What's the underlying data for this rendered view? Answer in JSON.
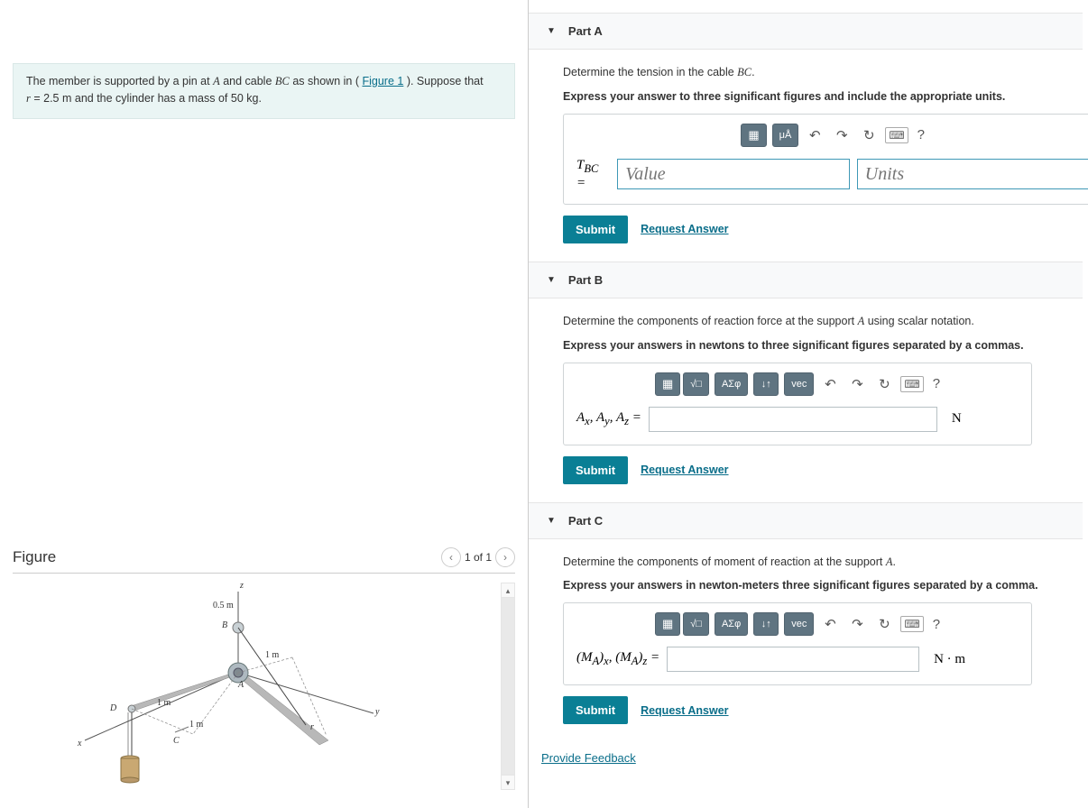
{
  "problem": {
    "text_before": "The member is supported by a pin at ",
    "varA": "A",
    "text_mid1": " and cable ",
    "varBC": "BC",
    "text_mid2": " as shown in (",
    "figure_link": "Figure 1",
    "text_mid3": "). Suppose that ",
    "varR": "r",
    "text_mid4": " = 2.5 m and the cylinder has a mass of 50 kg."
  },
  "figure": {
    "label": "Figure",
    "nav_text": "1 of 1",
    "labels": {
      "z": "z",
      "half_m": "0.5 m",
      "B": "B",
      "one_m_a": "1 m",
      "D": "D",
      "one_m_b": "1 m",
      "A": "A",
      "one_m_c": "1 m",
      "y": "y",
      "x": "x",
      "C": "C",
      "r": "r"
    }
  },
  "parts": {
    "a": {
      "title": "Part A",
      "prompt_before": "Determine the tension in the cable ",
      "prompt_var": "BC",
      "prompt_after": ".",
      "instruct": "Express your answer to three significant figures and include the appropriate units.",
      "toolbar": {
        "ua": "μÅ"
      },
      "label_html": "T<sub>BC</sub> =",
      "value_ph": "Value",
      "units_ph": "Units",
      "submit": "Submit",
      "request": "Request Answer"
    },
    "b": {
      "title": "Part B",
      "prompt_before": "Determine the components of reaction force at the support ",
      "prompt_var": "A",
      "prompt_after": " using scalar notation.",
      "instruct": "Express your answers in newtons to three significant figures separated by a commas.",
      "toolbar": {
        "sigma": "ΑΣφ",
        "sub": "↓↑",
        "vec": "vec"
      },
      "label": "Aₓ, Aᵧ, A_z =",
      "unit": "N",
      "submit": "Submit",
      "request": "Request Answer"
    },
    "c": {
      "title": "Part C",
      "prompt_before": "Determine the components of moment of reaction at the support ",
      "prompt_var": "A",
      "prompt_after": ".",
      "instruct": "Express your answers in newton-meters three significant figures separated by a comma.",
      "toolbar": {
        "sigma": "ΑΣφ",
        "sub": "↓↑",
        "vec": "vec"
      },
      "label": "(Mᴀ)ₓ, (Mᴀ)_z =",
      "unit": "N · m",
      "submit": "Submit",
      "request": "Request Answer"
    }
  },
  "feedback": "Provide Feedback"
}
